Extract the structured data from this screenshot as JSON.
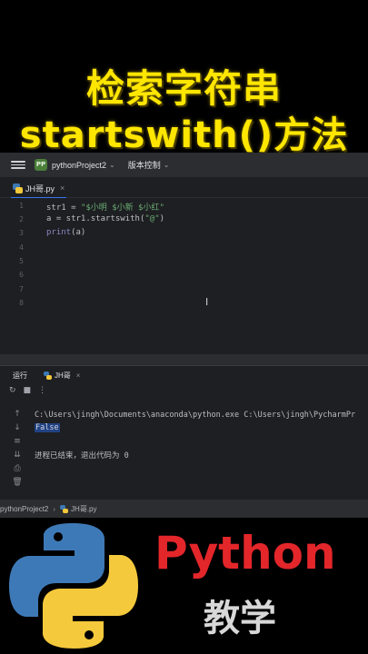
{
  "overlay": {
    "title_line1": "检索字符串",
    "title_line2": "startswith()方法",
    "bottom_title": "Python",
    "bottom_subtitle": "教学"
  },
  "toolbar": {
    "menu_icon": "hamburger-icon",
    "project_badge": "PP",
    "project_name": "pythonProject2",
    "vcs_label": "版本控制"
  },
  "editor": {
    "tab_label": "JH哥.py",
    "line_numbers": [
      "1",
      "2",
      "3",
      "4",
      "5",
      "6",
      "7",
      "8"
    ],
    "lines": [
      {
        "pre": "str1 = ",
        "str": "\"$小明 $小新 $小红\"",
        "post": ""
      },
      {
        "pre": "a = str1.startswith(",
        "str": "\"@\"",
        "post": ")"
      },
      {
        "pre": "",
        "fn": "print",
        "post": "(a)"
      }
    ]
  },
  "run": {
    "panel_label": "运行",
    "tab_label": "JH哥",
    "command": "C:\\Users\\jingh\\Documents\\anaconda\\python.exe C:\\Users\\jingh\\PycharmPr",
    "output": "False",
    "exit_message": "进程已结束，退出代码为 0"
  },
  "status": {
    "project": "pythonProject2",
    "file": "JH哥.py"
  },
  "colors": {
    "title_yellow": "#ffe600",
    "python_red": "#e3262a",
    "accent_blue": "#3574f0",
    "string_green": "#6aab73"
  }
}
